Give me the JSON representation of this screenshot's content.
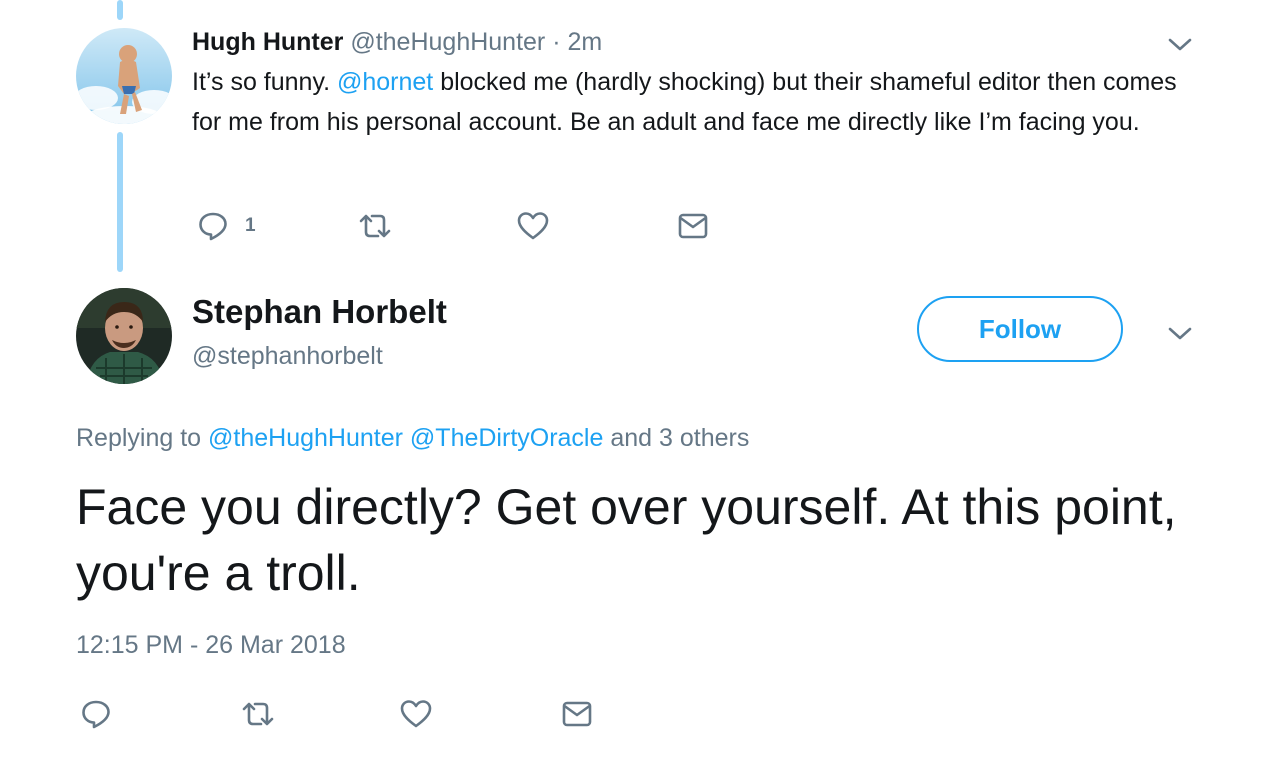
{
  "parent_tweet": {
    "name": "Hugh Hunter",
    "handle": "@theHughHunter",
    "separator": "·",
    "time": "2m",
    "text_before": "It’s so funny. ",
    "mention": "@hornet",
    "text_after": " blocked me (hardly shocking) but their shameful editor then comes for me from his personal account. Be an adult and face me directly like I’m facing you.",
    "actions": {
      "reply_icon": "reply-icon",
      "reply_count": "1",
      "retweet_icon": "retweet-icon",
      "like_icon": "heart-icon",
      "dm_icon": "envelope-icon"
    }
  },
  "main_tweet": {
    "name": "Stephan Horbelt",
    "handle": "@stephanhorbelt",
    "follow_label": "Follow",
    "replying_prefix": "Replying to ",
    "reply_mention_1": "@theHughHunter",
    "reply_mention_2": "@TheDirtyOracle",
    "replying_suffix": " and 3 others",
    "text": "Face you directly? Get over yourself. At this point, you're a troll.",
    "timestamp": "12:15 PM - 26 Mar 2018"
  },
  "colors": {
    "accent": "#1da1f2",
    "thread_line": "#9dd6f9",
    "secondary_text": "#657786",
    "primary_text": "#14171a"
  }
}
